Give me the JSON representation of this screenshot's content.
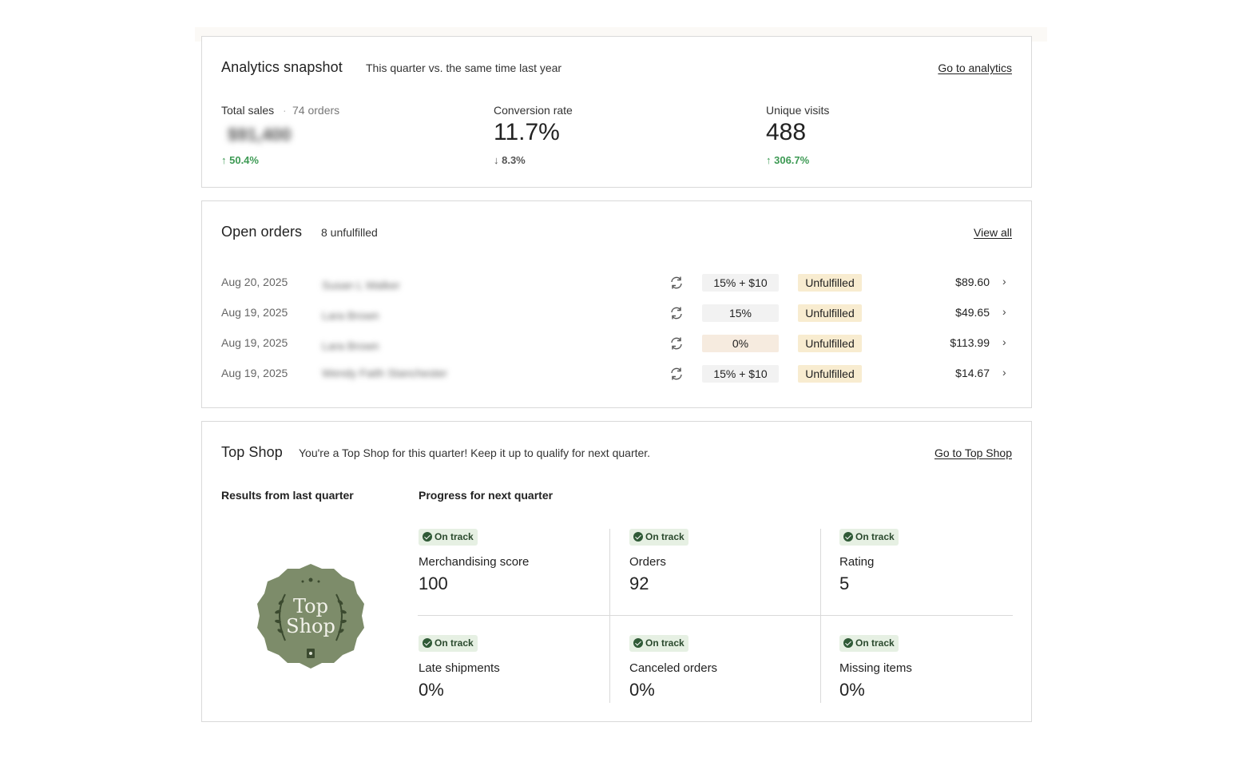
{
  "analytics": {
    "title": "Analytics snapshot",
    "subtitle": "This quarter vs. the same time last year",
    "link": "Go to analytics",
    "total_sales": {
      "label": "Total sales",
      "orders": "74 orders",
      "value": "$91,400",
      "change": "↑ 50.4%"
    },
    "conversion": {
      "label": "Conversion rate",
      "value": "11.7%",
      "change": "↓ 8.3%"
    },
    "visits": {
      "label": "Unique visits",
      "value": "488",
      "change": "↑ 306.7%"
    },
    "colors": {
      "positive": "#3d9a54",
      "neutral": "#555555"
    }
  },
  "orders": {
    "title": "Open orders",
    "subtitle": "8 unfulfilled",
    "link": "View all",
    "rows": [
      {
        "date": "Aug 20, 2025",
        "customer": "Susan L Walker",
        "discount": "15% + $10",
        "status": "Unfulfilled",
        "price": "$89.60"
      },
      {
        "date": "Aug 19, 2025",
        "customer": "Lara Brown",
        "discount": "15%",
        "status": "Unfulfilled",
        "price": "$49.65"
      },
      {
        "date": "Aug 19, 2025",
        "customer": "Lara Brown",
        "discount": "0%",
        "status": "Unfulfilled",
        "price": "$113.99"
      },
      {
        "date": "Aug 19, 2025",
        "customer": "Wendy Faith Stanchester",
        "discount": "15% + $10",
        "status": "Unfulfilled",
        "price": "$14.67"
      }
    ],
    "icons": {
      "sync": "sync-icon",
      "chevron": "chevron-right-icon"
    }
  },
  "topshop": {
    "title": "Top Shop",
    "subtitle": "You're a Top Shop for this quarter! Keep it up to qualify for next quarter.",
    "link": "Go to Top Shop",
    "results_label": "Results from last quarter",
    "progress_label": "Progress for next quarter",
    "badge_line1": "Top",
    "badge_line2": "Shop",
    "badge_color": "#7d8c6a",
    "stats": [
      {
        "status": "On track",
        "label": "Merchandising score",
        "value": "100"
      },
      {
        "status": "On track",
        "label": "Orders",
        "value": "92"
      },
      {
        "status": "On track",
        "label": "Rating",
        "value": "5"
      },
      {
        "status": "On track",
        "label": "Late shipments",
        "value": "0%"
      },
      {
        "status": "On track",
        "label": "Canceled orders",
        "value": "0%"
      },
      {
        "status": "On track",
        "label": "Missing items",
        "value": "0%"
      }
    ]
  }
}
